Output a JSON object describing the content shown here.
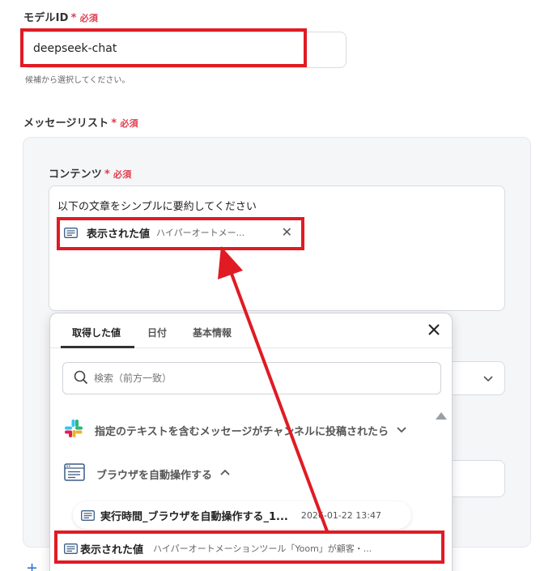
{
  "model": {
    "label": "モデルID",
    "required": "必須",
    "value": "deepseek-chat",
    "hint": "候補から選択してください。"
  },
  "message_list": {
    "label": "メッセージリスト",
    "required": "必須"
  },
  "content": {
    "label": "コンテンツ",
    "required": "必須",
    "text": "以下の文章をシンプルに要約してください",
    "chip_title": "表示された値",
    "chip_sub": "ハイパーオートメー...",
    "chip_close": "✕"
  },
  "popup": {
    "tabs": [
      "取得した値",
      "日付",
      "基本情報"
    ],
    "search_placeholder": "検索（前方一致）",
    "sections": [
      {
        "label": "指定のテキストを含むメッセージがチャンネルに投稿されたら",
        "icon": "slack-icon"
      },
      {
        "label": "ブラウザを自動操作する",
        "icon": "browser-icon"
      }
    ],
    "rows": [
      {
        "title": "実行時間_ブラウザを自動操作する_1...",
        "time": "2026-01-22 13:47"
      },
      {
        "title": "表示された値",
        "sub": "ハイパーオートメーションツール「Yoom」が顧客・..."
      }
    ]
  },
  "colors": {
    "highlight": "#e01b24",
    "required": "#e23c4b",
    "accent": "#2a6fd6"
  }
}
